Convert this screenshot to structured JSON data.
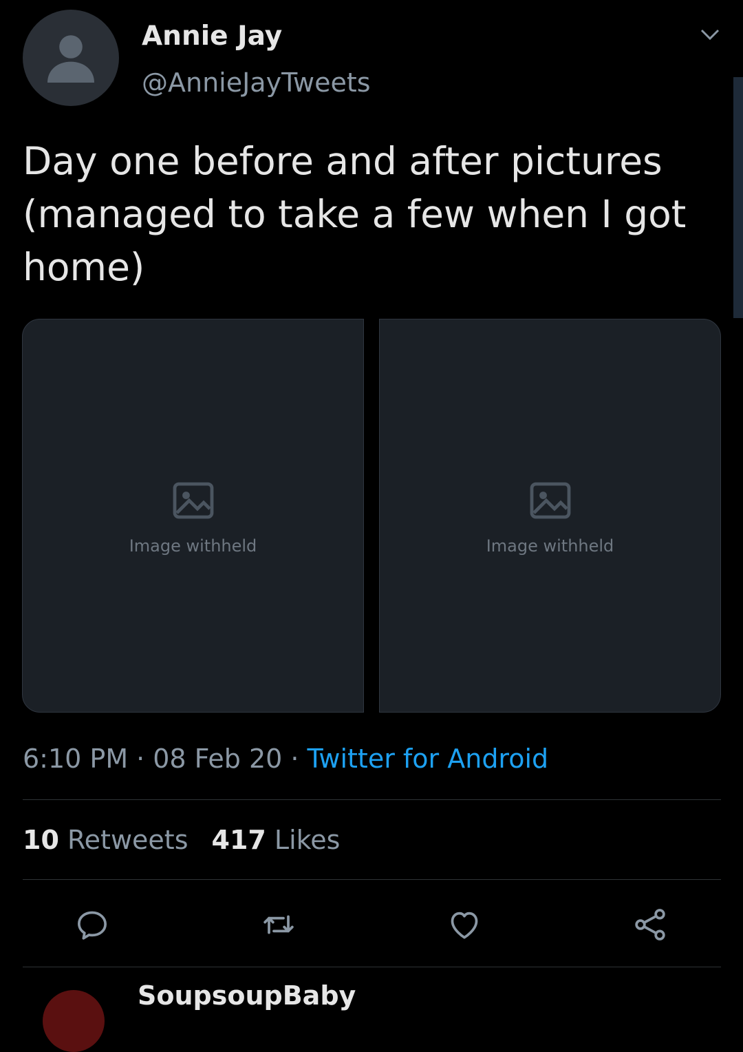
{
  "user": {
    "name": "Annie Jay",
    "handle": "@AnnieJayTweets"
  },
  "tweet": {
    "text": "Day one before and after pictures (managed to take a few when I got home)"
  },
  "media": {
    "left_note": "Image withheld",
    "right_note": "Image withheld"
  },
  "meta": {
    "time": "6:10 PM",
    "date": "08 Feb 20",
    "source": "Twitter for Android",
    "separator": "·"
  },
  "stats": {
    "retweets_count": "10",
    "retweets_label": "Retweets",
    "likes_count": "417",
    "likes_label": "Likes"
  },
  "next_reply": {
    "name": "SoupsoupBaby"
  },
  "colors": {
    "background": "#000000",
    "accent": "#1da1f2",
    "secondary_text": "#8b98a5"
  }
}
